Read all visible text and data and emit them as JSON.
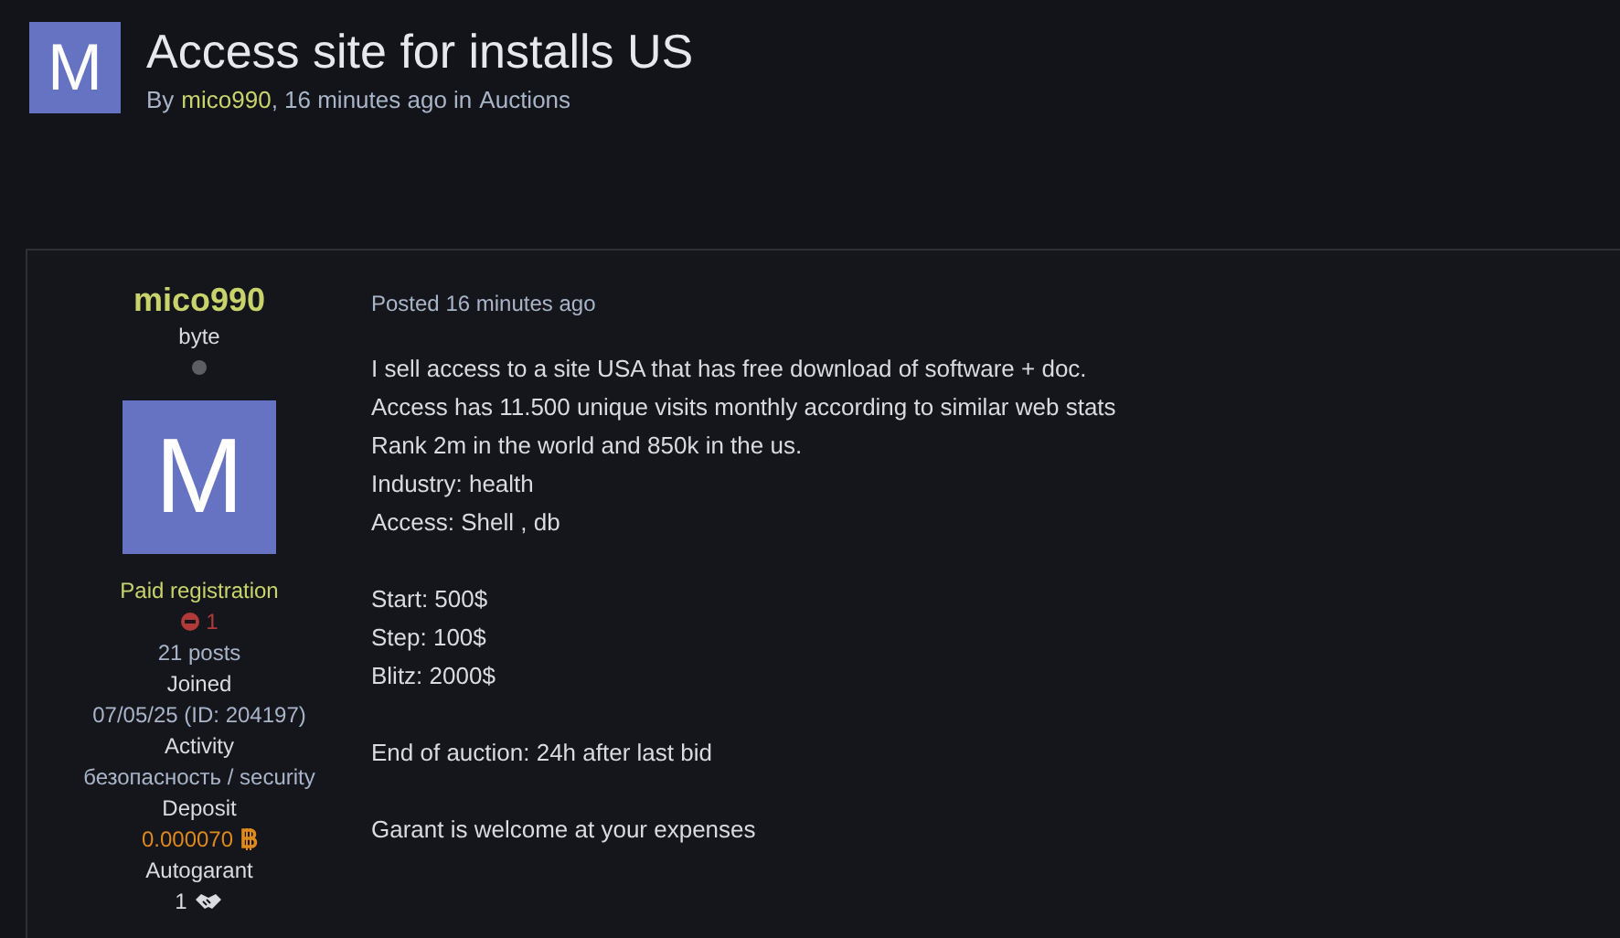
{
  "topic": {
    "avatar_letter": "M",
    "title": "Access site for installs US",
    "byline": {
      "prefix": "By",
      "author": "mico990",
      "time": ", 16 minutes ago in",
      "forum": "Auctions"
    }
  },
  "author_panel": {
    "name": "mico990",
    "rank": "byte",
    "online": false,
    "avatar_letter": "M",
    "group": "Paid registration",
    "warnings": "1",
    "posts": "21 posts",
    "fields": [
      {
        "label": "Joined",
        "value": "07/05/25 (ID: 204197)",
        "kind": "plain"
      },
      {
        "label": "Activity",
        "value": "безопасность / security",
        "kind": "plain"
      },
      {
        "label": "Deposit",
        "value": "0.000070",
        "kind": "bitcoin"
      },
      {
        "label": "Autogarant",
        "value": "1",
        "kind": "handshake"
      }
    ]
  },
  "post": {
    "posted": "Posted 16 minutes ago",
    "paragraphs": [
      [
        "I sell access to a site USA that has free download of software + doc.",
        "Access has 11.500 unique visits monthly according to similar web stats",
        "Rank 2m in the world and 850k in the us.",
        "Industry: health",
        "Access: Shell , db"
      ],
      [
        "Start: 500$",
        "Step: 100$",
        "Blitz: 2000$"
      ],
      [
        "End of auction: 24h after last bid"
      ],
      [
        "Garant is welcome at your expenses"
      ]
    ]
  }
}
